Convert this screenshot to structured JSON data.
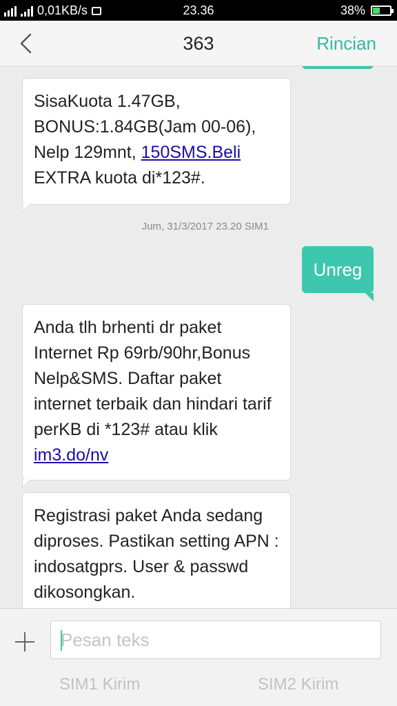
{
  "status_bar": {
    "network_speed": "0,01KB/s",
    "time": "23.36",
    "battery": "38%",
    "battery_level": 0.38
  },
  "header": {
    "title": "363",
    "action_label": "Rincian"
  },
  "messages": [
    {
      "direction": "incoming",
      "text_before": "SisaKuota 1.47GB, BONUS:1.84GB(Jam 00-06), Nelp 129mnt, ",
      "link": "150SMS.Beli",
      "text_after": " EXTRA kuota di*123#."
    },
    {
      "direction": "meta",
      "timestamp": "Jum, 31/3/2017  23.20  SIM1"
    },
    {
      "direction": "outgoing",
      "text": "Unreg"
    },
    {
      "direction": "incoming",
      "text_before": "Anda tlh brhenti dr paket Internet Rp 69rb/90hr,Bonus Nelp&SMS. Daftar paket internet terbaik dan hindari tarif perKB di *123# atau klik ",
      "link": "im3.do/nv",
      "text_after": ""
    },
    {
      "direction": "incoming",
      "text": "Registrasi paket Anda sedang diproses. Pastikan setting APN : indosatgprs. User & passwd dikosongkan."
    }
  ],
  "composer": {
    "placeholder": "Pesan teks",
    "send_sim1": "SIM1 Kirim",
    "send_sim2": "SIM2 Kirim"
  },
  "colors": {
    "accent": "#3cc7ae",
    "link": "#1a0dab",
    "background": "#ececec"
  }
}
